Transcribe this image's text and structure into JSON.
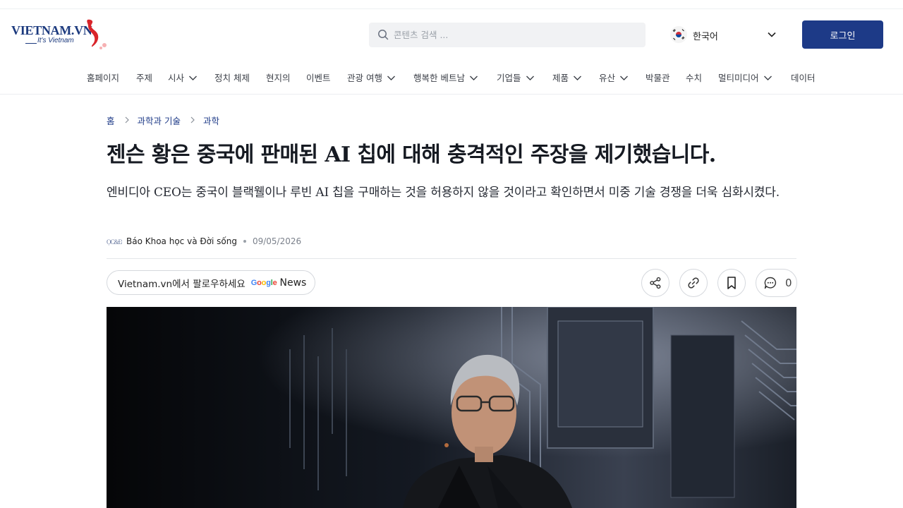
{
  "header": {
    "logo_text": "VIETNAM.VN",
    "logo_tagline": "It's Vietnam",
    "search_placeholder": "콘텐츠 검색 ...",
    "language": "한국어",
    "login_label": "로그인"
  },
  "nav": {
    "items": [
      {
        "label": "홈페이지",
        "dropdown": false
      },
      {
        "label": "주제",
        "dropdown": false
      },
      {
        "label": "시사",
        "dropdown": true
      },
      {
        "label": "정치 체제",
        "dropdown": false
      },
      {
        "label": "현지의",
        "dropdown": false
      },
      {
        "label": "이벤트",
        "dropdown": false
      },
      {
        "label": "관광 여행",
        "dropdown": true
      },
      {
        "label": "행복한 베트남",
        "dropdown": true
      },
      {
        "label": "기업들",
        "dropdown": true
      },
      {
        "label": "제품",
        "dropdown": true
      },
      {
        "label": "유산",
        "dropdown": true
      },
      {
        "label": "박물관",
        "dropdown": false
      },
      {
        "label": "수치",
        "dropdown": false
      },
      {
        "label": "멀티미디어",
        "dropdown": true
      },
      {
        "label": "데이터",
        "dropdown": false
      }
    ]
  },
  "breadcrumb": [
    "홈",
    "과학과 기술",
    "과학"
  ],
  "article": {
    "title": "젠슨 황은 중국에 판매된 AI 칩에 대해 충격적인 주장을 제기했습니다.",
    "lede": "엔비디아 CEO는 중국이 블랙웰이나 루빈 AI 칩을 구매하는 것을 허용하지 않을 것이라고 확인하면서 미중 기술 경쟁을 더욱 심화시켰다.",
    "source_logo_text": "KHOA HỌC & ĐỜI SỐNG",
    "source": "Báo Khoa học và Đời sống",
    "date": "09/05/2026"
  },
  "actions": {
    "follow_label": "Vietnam.vn에서 팔로우하세요",
    "google_word": "Google",
    "news_word": "News",
    "comment_count": "0"
  },
  "colors": {
    "brand_blue": "#1d3a87",
    "link_blue": "#1d3a87",
    "text_dark": "#161a22"
  }
}
